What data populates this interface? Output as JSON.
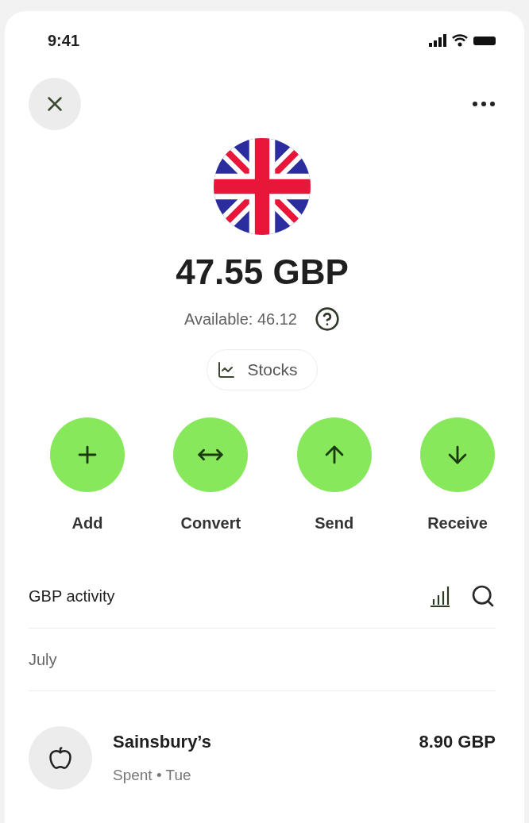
{
  "status_bar": {
    "time": "9:41"
  },
  "account": {
    "balance": "47.55 GBP",
    "available": "Available: 46.12",
    "stocks_label": "Stocks"
  },
  "actions": [
    {
      "kind": "add",
      "label": "Add"
    },
    {
      "kind": "convert",
      "label": "Convert"
    },
    {
      "kind": "send",
      "label": "Send"
    },
    {
      "kind": "receive",
      "label": "Receive"
    }
  ],
  "activity": {
    "title": "GBP activity",
    "groups": [
      {
        "month": "July",
        "transactions": [
          {
            "merchant": "Sainsbury’s",
            "amount": "8.90 GBP",
            "detail": "Spent • Tue"
          }
        ]
      }
    ]
  }
}
